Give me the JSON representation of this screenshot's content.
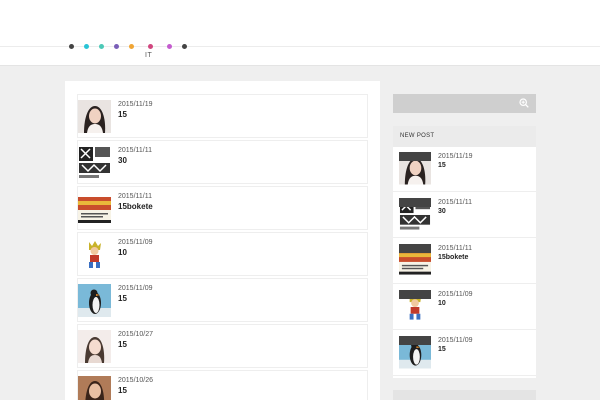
{
  "nav": {
    "dot_colors": [
      "#444444",
      "#29c4d6",
      "#4cc9b7",
      "#7a5fb8",
      "#f0a534",
      "#d1477f",
      "#c45ccf",
      "#444444"
    ],
    "label": "IT"
  },
  "posts": [
    {
      "date": "2015/11/19",
      "title": "15",
      "thumb": "woman-portrait"
    },
    {
      "date": "2015/11/11",
      "title": "30",
      "thumb": "manga-panel"
    },
    {
      "date": "2015/11/11",
      "title": "15bokete",
      "thumb": "tv-screen"
    },
    {
      "date": "2015/11/09",
      "title": "10",
      "thumb": "anime-character"
    },
    {
      "date": "2015/11/09",
      "title": "15",
      "thumb": "penguin"
    },
    {
      "date": "2015/10/27",
      "title": "15",
      "thumb": "woman-portrait-light"
    },
    {
      "date": "2015/10/26",
      "title": "15",
      "thumb": "woman-portrait-dark"
    }
  ],
  "sidebar": {
    "search_icon": "zoom-in-icon",
    "new_post_heading": "NEW POST",
    "posts": [
      {
        "date": "2015/11/19",
        "title": "15",
        "thumb": "woman-portrait"
      },
      {
        "date": "2015/11/11",
        "title": "30",
        "thumb": "manga-panel"
      },
      {
        "date": "2015/11/11",
        "title": "15bokete",
        "thumb": "tv-screen"
      },
      {
        "date": "2015/11/09",
        "title": "10",
        "thumb": "anime-character"
      },
      {
        "date": "2015/11/09",
        "title": "15",
        "thumb": "penguin"
      }
    ]
  }
}
